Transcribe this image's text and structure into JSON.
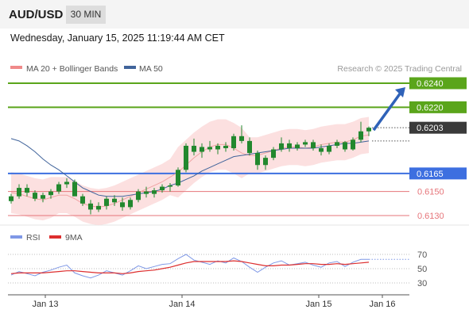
{
  "header": {
    "pair": "AUD/USD",
    "timeframe": "30 MIN"
  },
  "datetime": "Wednesday, January 15, 2025 11:19:44 AM CET",
  "legend": {
    "ma20": "MA 20 + Bollinger Bands",
    "ma50": "MA 50",
    "credit": "Research © 2025 Trading Central",
    "rsi": "RSI",
    "ma9": "9MA"
  },
  "colors": {
    "resistance": "#5aa51b",
    "support": "#3d6fe0",
    "minor": "#e6757a",
    "bands": "#fbdada",
    "ma20": "#f0a3a3",
    "ma50": "#41649b",
    "candle": "#22882e",
    "arrow": "#2f62b8",
    "current": "#3a3a3a",
    "rsi": "#7f98e6",
    "rsi_ma": "#dd2e2e"
  },
  "chart_data": [
    {
      "type": "candlestick",
      "title": "AUD/USD",
      "timeframe": "30 MIN",
      "ylim": [
        0.6125,
        0.6245
      ],
      "x_labels": [
        "Jan 13",
        "Jan 14",
        "Jan 15",
        "Jan 16"
      ],
      "current_price": "0.6203",
      "levels": [
        {
          "value": "0.6240",
          "role": "resistance"
        },
        {
          "value": "0.6220",
          "role": "resistance"
        },
        {
          "value": "0.6165",
          "role": "support"
        },
        {
          "value": "0.6150",
          "role": "minor"
        },
        {
          "value": "0.6130",
          "role": "minor"
        }
      ],
      "arrow": {
        "from": 0.6201,
        "to": 0.6238,
        "direction": "up"
      },
      "series": [
        {
          "name": "MA 20 + Bollinger Bands",
          "values": [
            0.6149,
            0.6148,
            0.6146,
            0.6144,
            0.6143,
            0.6145,
            0.6147,
            0.6147,
            0.6144,
            0.614,
            0.6138,
            0.6137,
            0.6138,
            0.614,
            0.6143,
            0.6146,
            0.6149,
            0.6152,
            0.6155,
            0.6158,
            0.6162,
            0.6166,
            0.6172,
            0.6178,
            0.6183,
            0.6187,
            0.6189,
            0.6189,
            0.6186,
            0.6182,
            0.618,
            0.618,
            0.6182,
            0.6184,
            0.6186,
            0.6187,
            0.6187,
            0.6186,
            0.6187,
            0.6189,
            0.619,
            0.6191,
            0.6191,
            0.6193,
            0.6196,
            0.6197
          ]
        },
        {
          "name": "MA 50",
          "values": [
            0.6194,
            0.6192,
            0.6188,
            0.6183,
            0.6177,
            0.6172,
            0.6168,
            0.6163,
            0.6158,
            0.6153,
            0.615,
            0.6147,
            0.6146,
            0.6146,
            0.6146,
            0.6147,
            0.6148,
            0.6149,
            0.615,
            0.6152,
            0.6155,
            0.6157,
            0.616,
            0.6163,
            0.6167,
            0.617,
            0.6173,
            0.6176,
            0.6179,
            0.618,
            0.6181,
            0.6182,
            0.6183,
            0.6184,
            0.6185,
            0.6186,
            0.6186,
            0.6186,
            0.6186,
            0.6187,
            0.6188,
            0.6189,
            0.619,
            0.619,
            0.6191,
            0.6192
          ]
        }
      ],
      "candles": [
        {
          "o": 0.6142,
          "h": 0.6148,
          "l": 0.614,
          "c": 0.6146
        },
        {
          "o": 0.6146,
          "h": 0.6156,
          "l": 0.6144,
          "c": 0.6153
        },
        {
          "o": 0.6153,
          "h": 0.6156,
          "l": 0.6146,
          "c": 0.6149
        },
        {
          "o": 0.6149,
          "h": 0.6151,
          "l": 0.6142,
          "c": 0.6144
        },
        {
          "o": 0.6144,
          "h": 0.6149,
          "l": 0.6141,
          "c": 0.6147
        },
        {
          "o": 0.6147,
          "h": 0.6152,
          "l": 0.6144,
          "c": 0.615
        },
        {
          "o": 0.615,
          "h": 0.6158,
          "l": 0.6148,
          "c": 0.6156
        },
        {
          "o": 0.6156,
          "h": 0.6161,
          "l": 0.6153,
          "c": 0.6158
        },
        {
          "o": 0.6158,
          "h": 0.616,
          "l": 0.6148,
          "c": 0.6146
        },
        {
          "o": 0.6146,
          "h": 0.6148,
          "l": 0.6138,
          "c": 0.614
        },
        {
          "o": 0.614,
          "h": 0.6143,
          "l": 0.6131,
          "c": 0.6135
        },
        {
          "o": 0.6135,
          "h": 0.6141,
          "l": 0.6133,
          "c": 0.6138
        },
        {
          "o": 0.6138,
          "h": 0.6146,
          "l": 0.6135,
          "c": 0.6144
        },
        {
          "o": 0.6144,
          "h": 0.6147,
          "l": 0.6138,
          "c": 0.6141
        },
        {
          "o": 0.6141,
          "h": 0.6145,
          "l": 0.6134,
          "c": 0.6137
        },
        {
          "o": 0.6137,
          "h": 0.6145,
          "l": 0.6135,
          "c": 0.6143
        },
        {
          "o": 0.6143,
          "h": 0.6152,
          "l": 0.6141,
          "c": 0.615
        },
        {
          "o": 0.615,
          "h": 0.6154,
          "l": 0.6145,
          "c": 0.6148
        },
        {
          "o": 0.6148,
          "h": 0.6153,
          "l": 0.6145,
          "c": 0.6151
        },
        {
          "o": 0.6151,
          "h": 0.6156,
          "l": 0.6149,
          "c": 0.6154
        },
        {
          "o": 0.6154,
          "h": 0.6157,
          "l": 0.615,
          "c": 0.6155
        },
        {
          "o": 0.6155,
          "h": 0.617,
          "l": 0.6154,
          "c": 0.6168
        },
        {
          "o": 0.6168,
          "h": 0.619,
          "l": 0.6166,
          "c": 0.6188
        },
        {
          "o": 0.6188,
          "h": 0.6194,
          "l": 0.618,
          "c": 0.6183
        },
        {
          "o": 0.6183,
          "h": 0.619,
          "l": 0.6178,
          "c": 0.6187
        },
        {
          "o": 0.6187,
          "h": 0.6192,
          "l": 0.6183,
          "c": 0.6185
        },
        {
          "o": 0.6185,
          "h": 0.619,
          "l": 0.6181,
          "c": 0.6188
        },
        {
          "o": 0.6188,
          "h": 0.6191,
          "l": 0.6183,
          "c": 0.6186
        },
        {
          "o": 0.6186,
          "h": 0.6198,
          "l": 0.6184,
          "c": 0.6196
        },
        {
          "o": 0.6196,
          "h": 0.6205,
          "l": 0.619,
          "c": 0.6192
        },
        {
          "o": 0.6192,
          "h": 0.6195,
          "l": 0.618,
          "c": 0.6182
        },
        {
          "o": 0.6182,
          "h": 0.6184,
          "l": 0.6168,
          "c": 0.6172
        },
        {
          "o": 0.6172,
          "h": 0.618,
          "l": 0.6168,
          "c": 0.6178
        },
        {
          "o": 0.6178,
          "h": 0.6187,
          "l": 0.6176,
          "c": 0.6185
        },
        {
          "o": 0.6185,
          "h": 0.6195,
          "l": 0.6183,
          "c": 0.619
        },
        {
          "o": 0.619,
          "h": 0.6193,
          "l": 0.6183,
          "c": 0.6186
        },
        {
          "o": 0.6186,
          "h": 0.6191,
          "l": 0.6184,
          "c": 0.6189
        },
        {
          "o": 0.6189,
          "h": 0.6193,
          "l": 0.6187,
          "c": 0.6191
        },
        {
          "o": 0.6191,
          "h": 0.6193,
          "l": 0.6184,
          "c": 0.6186
        },
        {
          "o": 0.6186,
          "h": 0.6189,
          "l": 0.618,
          "c": 0.6183
        },
        {
          "o": 0.6183,
          "h": 0.619,
          "l": 0.6181,
          "c": 0.6188
        },
        {
          "o": 0.6188,
          "h": 0.6193,
          "l": 0.6186,
          "c": 0.6191
        },
        {
          "o": 0.6191,
          "h": 0.6192,
          "l": 0.6183,
          "c": 0.6185
        },
        {
          "o": 0.6185,
          "h": 0.6195,
          "l": 0.6184,
          "c": 0.6193
        },
        {
          "o": 0.6193,
          "h": 0.6208,
          "l": 0.6191,
          "c": 0.62
        },
        {
          "o": 0.62,
          "h": 0.6204,
          "l": 0.6196,
          "c": 0.6203
        }
      ]
    },
    {
      "type": "line",
      "title": "RSI",
      "ylim": [
        20,
        80
      ],
      "y_ticks": [
        "70",
        "50",
        "30"
      ],
      "series": [
        {
          "name": "RSI",
          "values": [
            41,
            46,
            43,
            40,
            45,
            48,
            52,
            55,
            44,
            40,
            37,
            41,
            47,
            44,
            41,
            47,
            54,
            50,
            53,
            56,
            57,
            64,
            70,
            62,
            59,
            56,
            61,
            58,
            65,
            60,
            52,
            45,
            52,
            58,
            61,
            55,
            57,
            59,
            55,
            52,
            58,
            60,
            53,
            59,
            63,
            63
          ]
        },
        {
          "name": "9MA",
          "values": [
            43,
            44,
            44,
            44,
            44,
            45,
            46,
            47,
            47,
            46,
            45,
            44,
            44,
            44,
            43,
            44,
            46,
            47,
            48,
            50,
            52,
            55,
            58,
            60,
            60,
            60,
            60,
            60,
            61,
            60,
            58,
            56,
            54,
            54,
            55,
            55,
            56,
            57,
            57,
            56,
            56,
            57,
            56,
            57,
            58,
            59
          ]
        }
      ]
    }
  ]
}
